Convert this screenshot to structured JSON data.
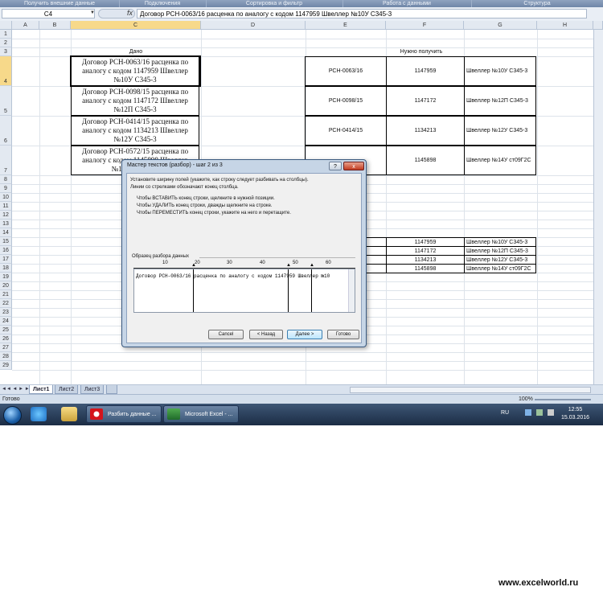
{
  "ribbon": {
    "groups": [
      "Получить внешние данные",
      "Подключения",
      "Сортировка и фильтр",
      "Работа с данными",
      "Структура"
    ]
  },
  "formula_bar": {
    "name_box": "C4",
    "fx_label": "fx",
    "content": "Договор РСН-0063/16 расценка по аналогу с кодом 1147959 Швеллер №10У С345-3"
  },
  "columns": [
    "A",
    "B",
    "C",
    "D",
    "E",
    "F",
    "G",
    "H"
  ],
  "rows": [
    "1",
    "2",
    "3",
    "4",
    "5",
    "6",
    "7",
    "8",
    "9",
    "10",
    "11",
    "12",
    "13",
    "14",
    "15",
    "16",
    "17",
    "18",
    "19",
    "20",
    "21",
    "22",
    "23",
    "24",
    "25",
    "26",
    "27",
    "28",
    "29"
  ],
  "sheet": {
    "header_given": "Дано",
    "header_need": "Нужно получить",
    "given": [
      "Договор РСН-0063/16 расценка по аналогу с кодом 1147959 Швеллер №10У С345-3",
      "Договор РСН-0098/15 расценка по аналогу с кодом 1147172 Швеллер №12П С345-3",
      "Договор РСН-0414/15 расценка по аналогу с кодом 1134213 Швеллер №12У С345-3",
      "Договор РСН-0572/15 расценка по аналогу с кодом 1145898 Швеллер №14У ст09Г2С"
    ],
    "result": [
      [
        "РСН-0063/16",
        "1147959",
        "Швеллер №10У С345-3"
      ],
      [
        "РСН-0098/15",
        "1147172",
        "Швеллер №12П С345-3"
      ],
      [
        "РСН-0414/15",
        "1134213",
        "Швеллер №12У С345-3"
      ],
      [
        "",
        "1145898",
        "Швеллер №14У ст09Г2С"
      ]
    ],
    "lower": [
      [
        "1147959",
        "Швеллер №10У С345-3"
      ],
      [
        "1147172",
        "Швеллер №12П С345-3"
      ],
      [
        "1134213",
        "Швеллер №12У С345-3"
      ],
      [
        "1145898",
        "Швеллер №14У ст09Г2С"
      ]
    ]
  },
  "sheet_tabs": [
    "Лист1",
    "Лист2",
    "Лист3"
  ],
  "status": {
    "ready": "Готово",
    "zoom": "100%"
  },
  "taskbar": {
    "tasks": [
      "Разбить данные ...",
      "Microsoft Excel - ..."
    ],
    "lang": "RU",
    "time": "12:55",
    "date": "15.03.2016"
  },
  "dialog": {
    "title": "Мастер текстов (разбор) - шаг 2 из 3",
    "help": "?",
    "close": "x",
    "intro1": "Установите ширину полей (укажите, как строку следует разбивать на столбцы).",
    "intro2": "Линии со стрелками обозначают конец столбца.",
    "hint1": "Чтобы ВСТАВИТЬ конец строки, щелкните в нужной позиции.",
    "hint2": "Чтобы УДАЛИТЬ конец строки, дважды щелкните на строке.",
    "hint3": "Чтобы ПЕРЕМЕСТИТЬ конец строки, укажите на него и перетащите.",
    "preview_label": "Образец разбора данных",
    "ruler": [
      "10",
      "20",
      "30",
      "40",
      "50",
      "60"
    ],
    "preview_line": "Договор РСН-0063/16 расценка по аналогу с кодом 1147959 Швеллер №10",
    "buttons": {
      "cancel": "Cancel",
      "back": "< Назад",
      "next": "Далее >",
      "finish": "Готово"
    }
  },
  "watermark": "www.excelworld.ru"
}
